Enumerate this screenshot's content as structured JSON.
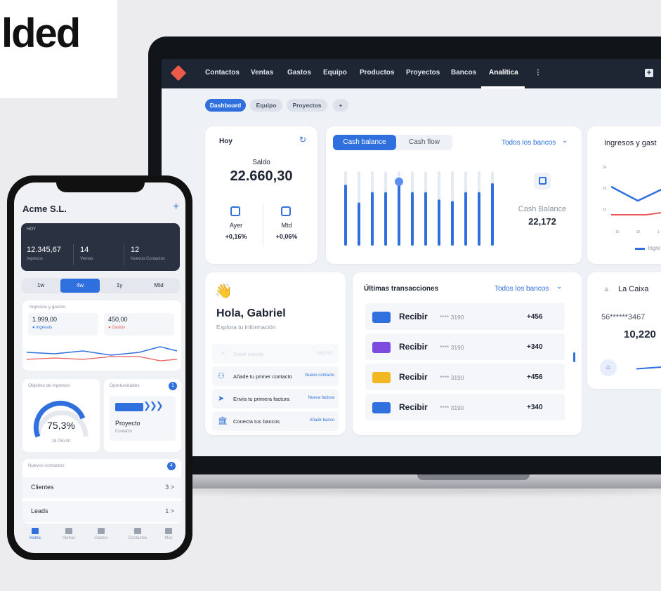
{
  "brand": {
    "text": "lded"
  },
  "desktop": {
    "nav": [
      "Contactos",
      "Ventas",
      "Gastos",
      "Equipo",
      "Productos",
      "Proyectos",
      "Bancos",
      "Analítica"
    ],
    "nav_more": "⋮",
    "nav_plus": "+",
    "tabs": [
      "Dashboard",
      "Equipo",
      "Proyectos",
      "+"
    ],
    "today": {
      "title": "Hoy",
      "saldo_label": "Saldo",
      "saldo_value": "22.660,30",
      "ayer_label": "Ayer",
      "ayer_value": "+0,16%",
      "mtd_label": "Mtd",
      "mtd_value": "+0,06%"
    },
    "cash": {
      "tab_active": "Cash balance",
      "tab_other": "Cash flow",
      "banks": "Todos los bancos",
      "label": "Cash Balance",
      "value": "22,172",
      "bars": [
        0.82,
        0.58,
        0.72,
        0.72,
        0.86,
        0.72,
        0.72,
        0.62,
        0.6,
        0.72,
        0.72,
        0.84
      ]
    },
    "ingresos": {
      "title": "Ingresos y gast",
      "ticks_y": [
        "3k",
        "2k",
        "1k"
      ],
      "ticks_x": [
        "15",
        "16",
        "1"
      ],
      "legend": "Ingre"
    },
    "welcome": {
      "emoji": "👋",
      "title": "Hola, Gabriel",
      "subtitle": "Explora tu información",
      "steps": [
        {
          "label": "Crear cuenta",
          "action": "HECHO"
        },
        {
          "label": "Añade tu primer contacto",
          "action": "Nuevo contacto"
        },
        {
          "label": "Envía tu primera factura",
          "action": "Nueva factura"
        },
        {
          "label": "Conecta tus bancos",
          "action": "Añadir banco"
        }
      ]
    },
    "transactions": {
      "title": "Últimas transacciones",
      "banks": "Todos los bancos",
      "rows": [
        {
          "label": "Recibir",
          "account": "**** 3190",
          "amount": "+456",
          "color": "#2f6fde"
        },
        {
          "label": "Recibir",
          "account": "**** 3190",
          "amount": "+340",
          "color": "#7b4be0"
        },
        {
          "label": "Recibir",
          "account": "**** 3190",
          "amount": "+456",
          "color": "#f2b824"
        },
        {
          "label": "Recibir",
          "account": "**** 3190",
          "amount": "+340",
          "color": "#2f6fde"
        }
      ]
    },
    "bank": {
      "name": "La Caixa",
      "account": "56******3467",
      "balance": "10,220"
    }
  },
  "mobile": {
    "company": "Acme S.L.",
    "plus": "+",
    "hoy": {
      "label": "HOY",
      "ingresos_value": "12.345,67",
      "ingresos_label": "Ingresos",
      "ventas_value": "14",
      "ventas_label": "Ventas",
      "contactos_value": "12",
      "contactos_label": "Nuevos Contactos"
    },
    "periods": [
      "1w",
      "4w",
      "1y",
      "Mtd"
    ],
    "ig": {
      "title": "Ingresos y gastos",
      "ingresos_value": "1.999,00",
      "ingresos_label": "Ingresos",
      "gastos_value": "450,00",
      "gastos_label": "Gastos"
    },
    "objetivo": {
      "title": "Objetivo de ingresos",
      "percent": "75,3%",
      "target": "18.750,00",
      "progress": 0.753
    },
    "oportunidades": {
      "title": "Oportunidades",
      "badge": "1",
      "name": "Proyecto",
      "sub": "Contacto"
    },
    "contactos": {
      "title": "Nuevos contactos",
      "badge": "4",
      "rows": [
        {
          "label": "Clientes",
          "count": "3 >"
        },
        {
          "label": "Leads",
          "count": "1 >"
        }
      ]
    },
    "tabbar": [
      "Home",
      "Ventas",
      "Gastos",
      "Contactos",
      "Más"
    ]
  }
}
